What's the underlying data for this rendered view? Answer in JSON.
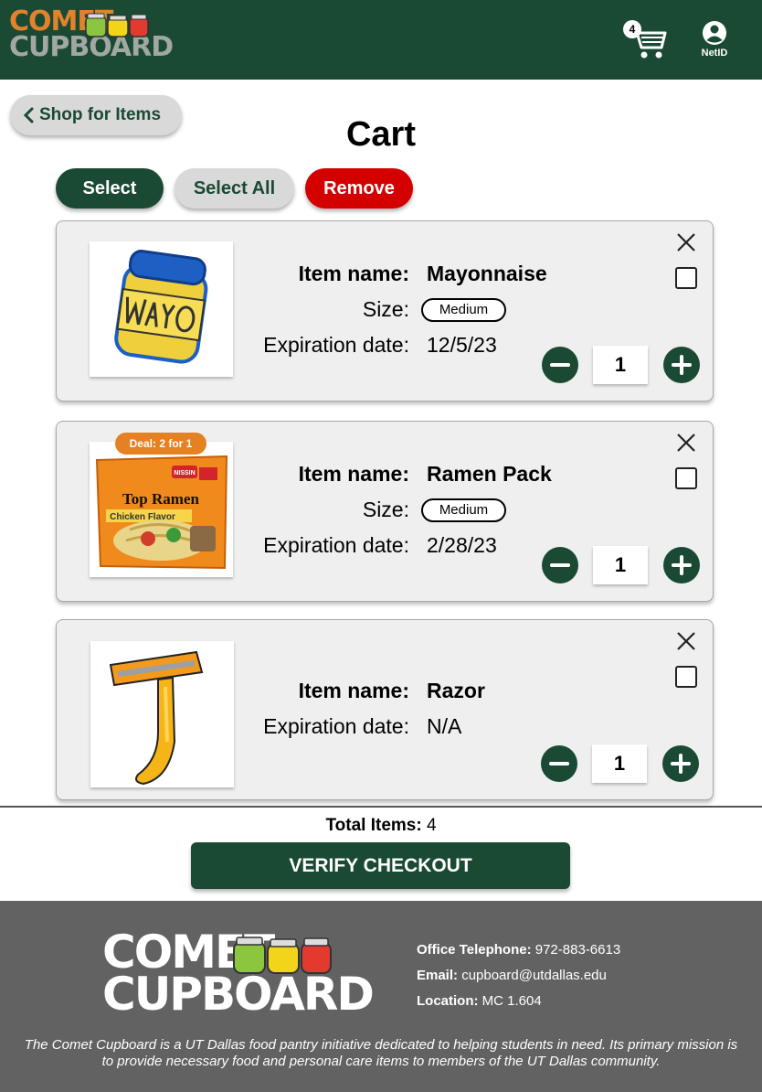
{
  "header": {
    "logo_line1": "COMET",
    "logo_line2": "CUPBOARD",
    "cart_count": "4",
    "netid_label": "NetID"
  },
  "nav": {
    "back_label": "Shop for Items"
  },
  "page_title": "Cart",
  "actions": {
    "select": "Select",
    "select_all": "Select All",
    "remove": "Remove"
  },
  "labels": {
    "item_name": "Item name:",
    "size": "Size:",
    "expiration": "Expiration date:"
  },
  "items": [
    {
      "name": "Mayonnaise",
      "size": "Medium",
      "expiration": "12/5/23",
      "quantity": "1",
      "image_icon": "mayo-jar-icon",
      "deal": ""
    },
    {
      "name": "Ramen Pack",
      "size": "Medium",
      "expiration": "2/28/23",
      "quantity": "1",
      "image_icon": "ramen-pack-icon",
      "deal": "Deal: 2 for 1",
      "package_text": "Top Ramen",
      "flavor_text": "Chicken Flavor",
      "brand_text": "NISSIN"
    },
    {
      "name": "Razor",
      "size": "",
      "expiration": "N/A",
      "quantity": "1",
      "image_icon": "razor-icon",
      "deal": ""
    }
  ],
  "summary": {
    "total_label": "Total Items:",
    "total_value": "4",
    "checkout_label": "VERIFY CHECKOUT"
  },
  "footer": {
    "phone_label": "Office Telephone:",
    "phone_value": "972-883-6613",
    "email_label": "Email:",
    "email_value": "cupboard@utdallas.edu",
    "location_label": "Location:",
    "location_value": "MC 1.604",
    "mission": "The Comet Cupboard is a UT Dallas food pantry initiative dedicated to helping students in need. Its primary mission is to provide necessary food and personal care items to members of the UT Dallas community."
  },
  "colors": {
    "brand_green": "#1a4a33",
    "remove_red": "#d40000",
    "deal_orange": "#e58122",
    "footer_gray": "#626262"
  }
}
